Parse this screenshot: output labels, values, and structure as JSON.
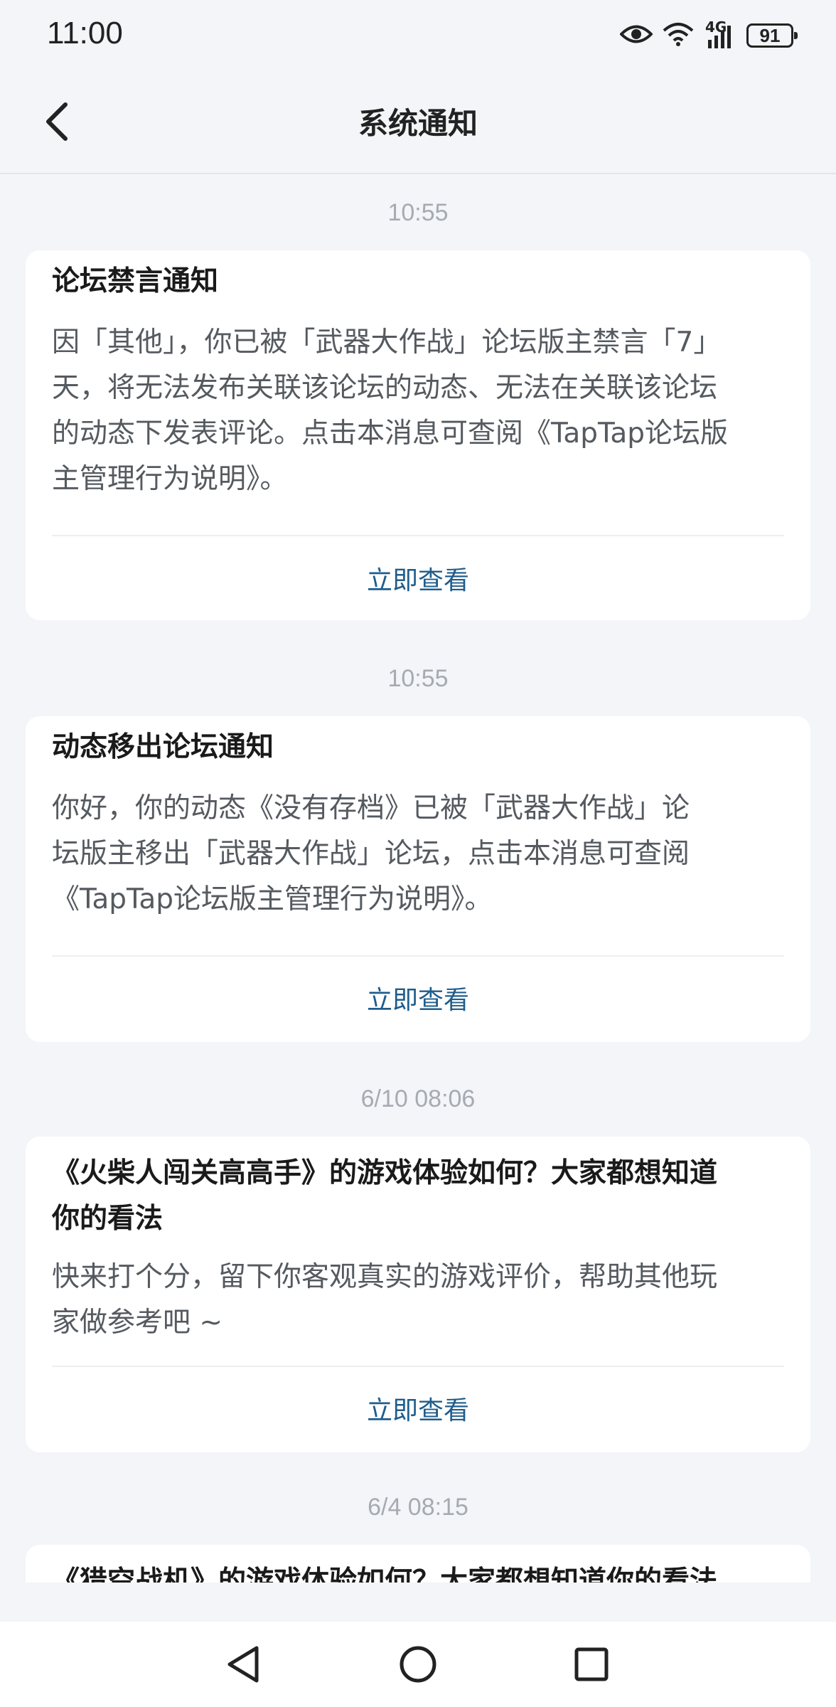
{
  "status_bar": {
    "time": "11:00",
    "battery": "91",
    "network": "4G",
    "icons": [
      "eye-icon",
      "wifi-icon",
      "signal-icon",
      "battery-icon"
    ]
  },
  "header": {
    "title": "系统通知",
    "back_icon": "chevron-left-icon"
  },
  "notifications": [
    {
      "time": "10:55",
      "title": "论坛禁言通知",
      "body_lines": [
        "因「其他」，你已被「武器大作战」论坛版主禁言「7」",
        "天，将无法发布关联该论坛的动态、无法在关联该论坛",
        "的动态下发表评论。点击本消息可查阅《TapTap论坛版",
        "主管理行为说明》。"
      ],
      "action": "立即查看"
    },
    {
      "time": "10:55",
      "title": "动态移出论坛通知",
      "body_lines": [
        "你好，你的动态《没有存档》已被「武器大作战」论",
        "坛版主移出「武器大作战」论坛，点击本消息可查阅",
        "《TapTap论坛版主管理行为说明》。"
      ],
      "action": "立即查看"
    },
    {
      "time": "6/10  08:06",
      "title_lines": [
        "《火柴人闯关高高手》的游戏体验如何？大家都想知道",
        "你的看法"
      ],
      "body_lines": [
        "快来打个分，留下你客观真实的游戏评价，帮助其他玩",
        "家做参考吧 ~"
      ],
      "action": "立即查看"
    },
    {
      "time": "6/4  08:15",
      "title": "《猎空战机》的游戏体验如何？大家都想知道你的看法"
    }
  ],
  "nav_bar": {
    "back_icon": "triangle-back-icon",
    "home_icon": "circle-home-icon",
    "recents_icon": "square-recents-icon"
  },
  "colors": {
    "background": "#f3f5f8",
    "card": "#ffffff",
    "action_link": "#1f5d8c",
    "timestamp": "#a6abb2"
  }
}
